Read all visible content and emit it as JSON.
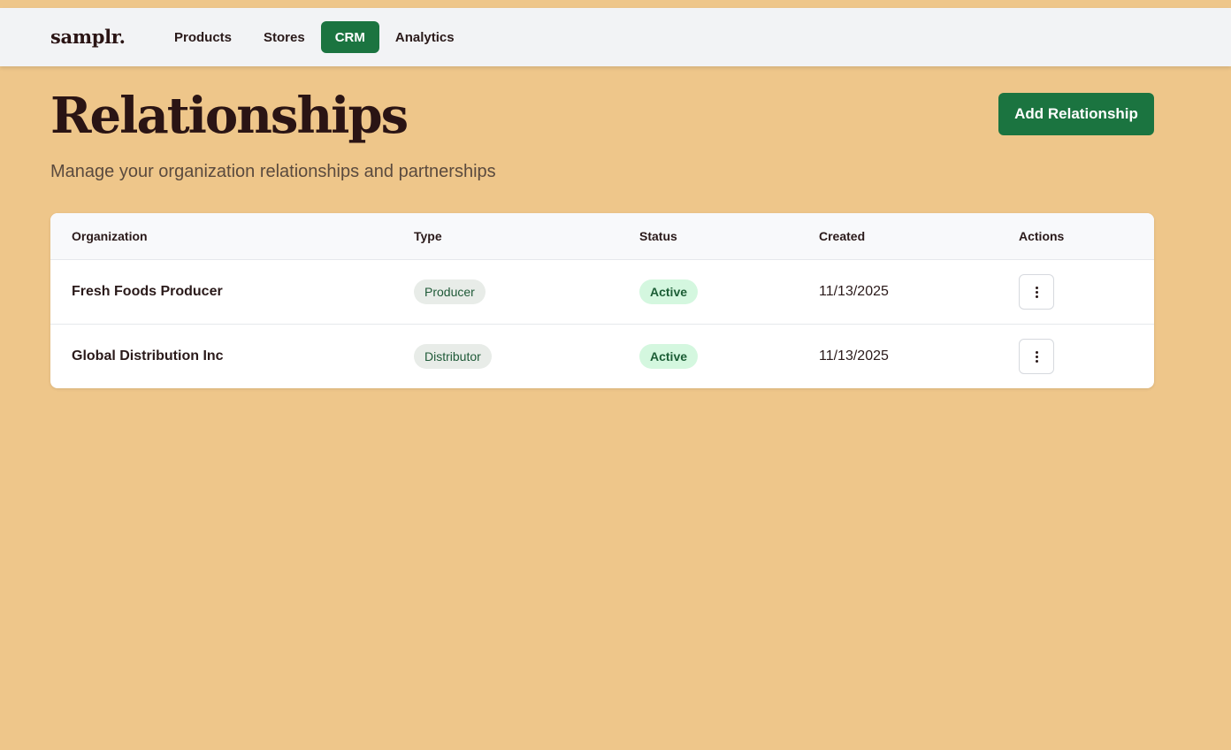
{
  "nav": {
    "logo": "samplr.",
    "items": [
      {
        "label": "Products",
        "active": false
      },
      {
        "label": "Stores",
        "active": false
      },
      {
        "label": "CRM",
        "active": true
      },
      {
        "label": "Analytics",
        "active": false
      }
    ]
  },
  "header": {
    "title": "Relationships",
    "subtitle": "Manage your organization relationships and partnerships",
    "add_button_label": "Add Relationship"
  },
  "table": {
    "columns": [
      "Organization",
      "Type",
      "Status",
      "Created",
      "Actions"
    ],
    "rows": [
      {
        "organization": "Fresh Foods Producer",
        "type": "Producer",
        "status": "Active",
        "created": "11/13/2025"
      },
      {
        "organization": "Global Distribution Inc",
        "type": "Distributor",
        "status": "Active",
        "created": "11/13/2025"
      }
    ]
  },
  "colors": {
    "background": "#eec68a",
    "accent": "#1b7440",
    "navbar": "#f2f3f5",
    "status_active_bg": "#d4f7df"
  },
  "icons": {
    "row_action": "more-vertical-icon"
  }
}
